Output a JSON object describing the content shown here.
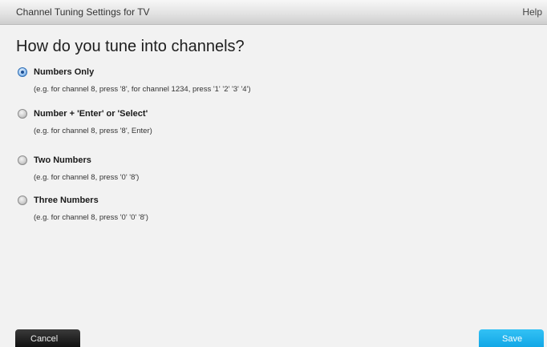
{
  "window": {
    "title": "Channel Tuning Settings for TV",
    "help_label": "Help"
  },
  "main": {
    "heading": "How do you tune into channels?",
    "options": [
      {
        "label": "Numbers Only",
        "description": "(e.g. for channel 8, press '8', for channel 1234, press '1' '2' '3' '4')",
        "selected": true
      },
      {
        "label": "Number + 'Enter' or 'Select'",
        "description": "(e.g. for channel 8, press '8', Enter)",
        "selected": false
      },
      {
        "label": "Two Numbers",
        "description": "(e.g. for channel 8, press '0' '8')",
        "selected": false
      },
      {
        "label": "Three Numbers",
        "description": "(e.g. for channel 8, press '0' '0' '8')",
        "selected": false
      }
    ]
  },
  "footer": {
    "cancel_label": "Cancel",
    "save_label": "Save"
  },
  "colors": {
    "accent_save": "#1aaeea",
    "cancel_button": "#1a1a1a",
    "radio_selected": "#3a7fc8"
  }
}
